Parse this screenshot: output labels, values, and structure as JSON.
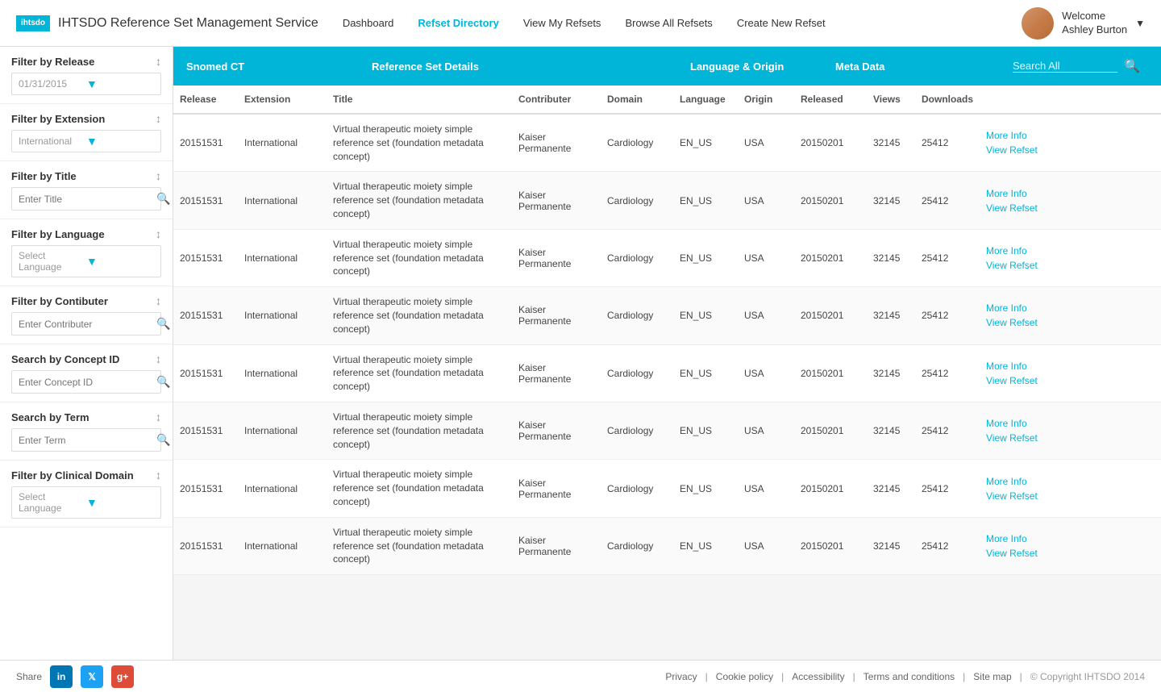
{
  "header": {
    "logo_text": "ihtsdo",
    "app_title": "IHTSDO Reference Set Management Service",
    "nav": [
      {
        "label": "Dashboard",
        "active": false
      },
      {
        "label": "Refset Directory",
        "active": true
      },
      {
        "label": "View My Refsets",
        "active": false
      },
      {
        "label": "Browse All Refsets",
        "active": false
      },
      {
        "label": "Create New Refset",
        "active": false
      }
    ],
    "user_greeting": "Welcome",
    "user_name": "Ashley Burton"
  },
  "sidebar": {
    "filters": [
      {
        "id": "filter-release",
        "label": "Filter by Release",
        "type": "dropdown",
        "value": "01/31/2015",
        "placeholder": "01/31/2015"
      },
      {
        "id": "filter-extension",
        "label": "Filter by Extension",
        "type": "dropdown",
        "value": "International",
        "placeholder": "International"
      },
      {
        "id": "filter-title",
        "label": "Filter by Title",
        "type": "search",
        "placeholder": "Enter Title"
      },
      {
        "id": "filter-language",
        "label": "Filter by Language",
        "type": "dropdown",
        "value": "",
        "placeholder": "Select Language"
      },
      {
        "id": "filter-contributer",
        "label": "Filter by Contibuter",
        "type": "search",
        "placeholder": "Enter Contributer"
      },
      {
        "id": "search-concept",
        "label": "Search by Concept ID",
        "type": "search",
        "placeholder": "Enter Concept ID"
      },
      {
        "id": "search-term",
        "label": "Search by Term",
        "type": "search",
        "placeholder": "Enter Term"
      },
      {
        "id": "filter-clinical-domain",
        "label": "Filter by Clinical Domain",
        "type": "dropdown",
        "value": "",
        "placeholder": "Select Language"
      }
    ]
  },
  "table": {
    "header_sections": [
      {
        "label": "Snomed CT",
        "key": "snomed"
      },
      {
        "label": "Reference Set Details",
        "key": "refset"
      },
      {
        "label": "Language & Origin",
        "key": "lang"
      },
      {
        "label": "Meta Data",
        "key": "meta"
      },
      {
        "label": "Search All",
        "key": "search"
      }
    ],
    "columns": [
      {
        "label": "Release",
        "key": "release"
      },
      {
        "label": "Extension",
        "key": "extension"
      },
      {
        "label": "Title",
        "key": "title"
      },
      {
        "label": "Contributer",
        "key": "contributer"
      },
      {
        "label": "Domain",
        "key": "domain"
      },
      {
        "label": "Language",
        "key": "language"
      },
      {
        "label": "Origin",
        "key": "origin"
      },
      {
        "label": "Released",
        "key": "released"
      },
      {
        "label": "Views",
        "key": "views"
      },
      {
        "label": "Downloads",
        "key": "downloads"
      }
    ],
    "rows": [
      {
        "release": "20151531",
        "extension": "International",
        "title": "Virtual therapeutic moiety simple reference set (foundation metadata concept)",
        "contributer": "Kaiser Permanente",
        "domain": "Cardiology",
        "language": "EN_US",
        "origin": "USA",
        "released": "20150201",
        "views": "32145",
        "downloads": "25412",
        "more_info": "More Info",
        "view_refset": "View Refset"
      },
      {
        "release": "20151531",
        "extension": "International",
        "title": "Virtual therapeutic moiety simple reference set (foundation metadata concept)",
        "contributer": "Kaiser Permanente",
        "domain": "Cardiology",
        "language": "EN_US",
        "origin": "USA",
        "released": "20150201",
        "views": "32145",
        "downloads": "25412",
        "more_info": "More Info",
        "view_refset": "View Refset"
      },
      {
        "release": "20151531",
        "extension": "International",
        "title": "Virtual therapeutic moiety simple reference set (foundation metadata concept)",
        "contributer": "Kaiser Permanente",
        "domain": "Cardiology",
        "language": "EN_US",
        "origin": "USA",
        "released": "20150201",
        "views": "32145",
        "downloads": "25412",
        "more_info": "More Info",
        "view_refset": "View Refset"
      },
      {
        "release": "20151531",
        "extension": "International",
        "title": "Virtual therapeutic moiety simple reference set (foundation metadata concept)",
        "contributer": "Kaiser Permanente",
        "domain": "Cardiology",
        "language": "EN_US",
        "origin": "USA",
        "released": "20150201",
        "views": "32145",
        "downloads": "25412",
        "more_info": "More Info",
        "view_refset": "View Refset"
      },
      {
        "release": "20151531",
        "extension": "International",
        "title": "Virtual therapeutic moiety simple reference set (foundation metadata concept)",
        "contributer": "Kaiser Permanente",
        "domain": "Cardiology",
        "language": "EN_US",
        "origin": "USA",
        "released": "20150201",
        "views": "32145",
        "downloads": "25412",
        "more_info": "More Info",
        "view_refset": "View Refset"
      },
      {
        "release": "20151531",
        "extension": "International",
        "title": "Virtual therapeutic moiety simple reference set (foundation metadata concept)",
        "contributer": "Kaiser Permanente",
        "domain": "Cardiology",
        "language": "EN_US",
        "origin": "USA",
        "released": "20150201",
        "views": "32145",
        "downloads": "25412",
        "more_info": "More Info",
        "view_refset": "View Refset"
      },
      {
        "release": "20151531",
        "extension": "International",
        "title": "Virtual therapeutic moiety simple reference set (foundation metadata concept)",
        "contributer": "Kaiser Permanente",
        "domain": "Cardiology",
        "language": "EN_US",
        "origin": "USA",
        "released": "20150201",
        "views": "32145",
        "downloads": "25412",
        "more_info": "More Info",
        "view_refset": "View Refset"
      },
      {
        "release": "20151531",
        "extension": "International",
        "title": "Virtual therapeutic moiety simple reference set (foundation metadata concept)",
        "contributer": "Kaiser Permanente",
        "domain": "Cardiology",
        "language": "EN_US",
        "origin": "USA",
        "released": "20150201",
        "views": "32145",
        "downloads": "25412",
        "more_info": "More Info",
        "view_refset": "View Refset"
      }
    ]
  },
  "footer": {
    "share_label": "Share",
    "links": [
      {
        "label": "Privacy"
      },
      {
        "label": "Cookie policy"
      },
      {
        "label": "Accessibility"
      },
      {
        "label": "Terms and conditions"
      },
      {
        "label": "Site map"
      },
      {
        "label": "© Copyright IHTSDO 2014"
      }
    ],
    "social": [
      {
        "label": "in",
        "class": "social-li"
      },
      {
        "label": "t",
        "class": "social-tw"
      },
      {
        "label": "g+",
        "class": "social-gp"
      }
    ]
  }
}
